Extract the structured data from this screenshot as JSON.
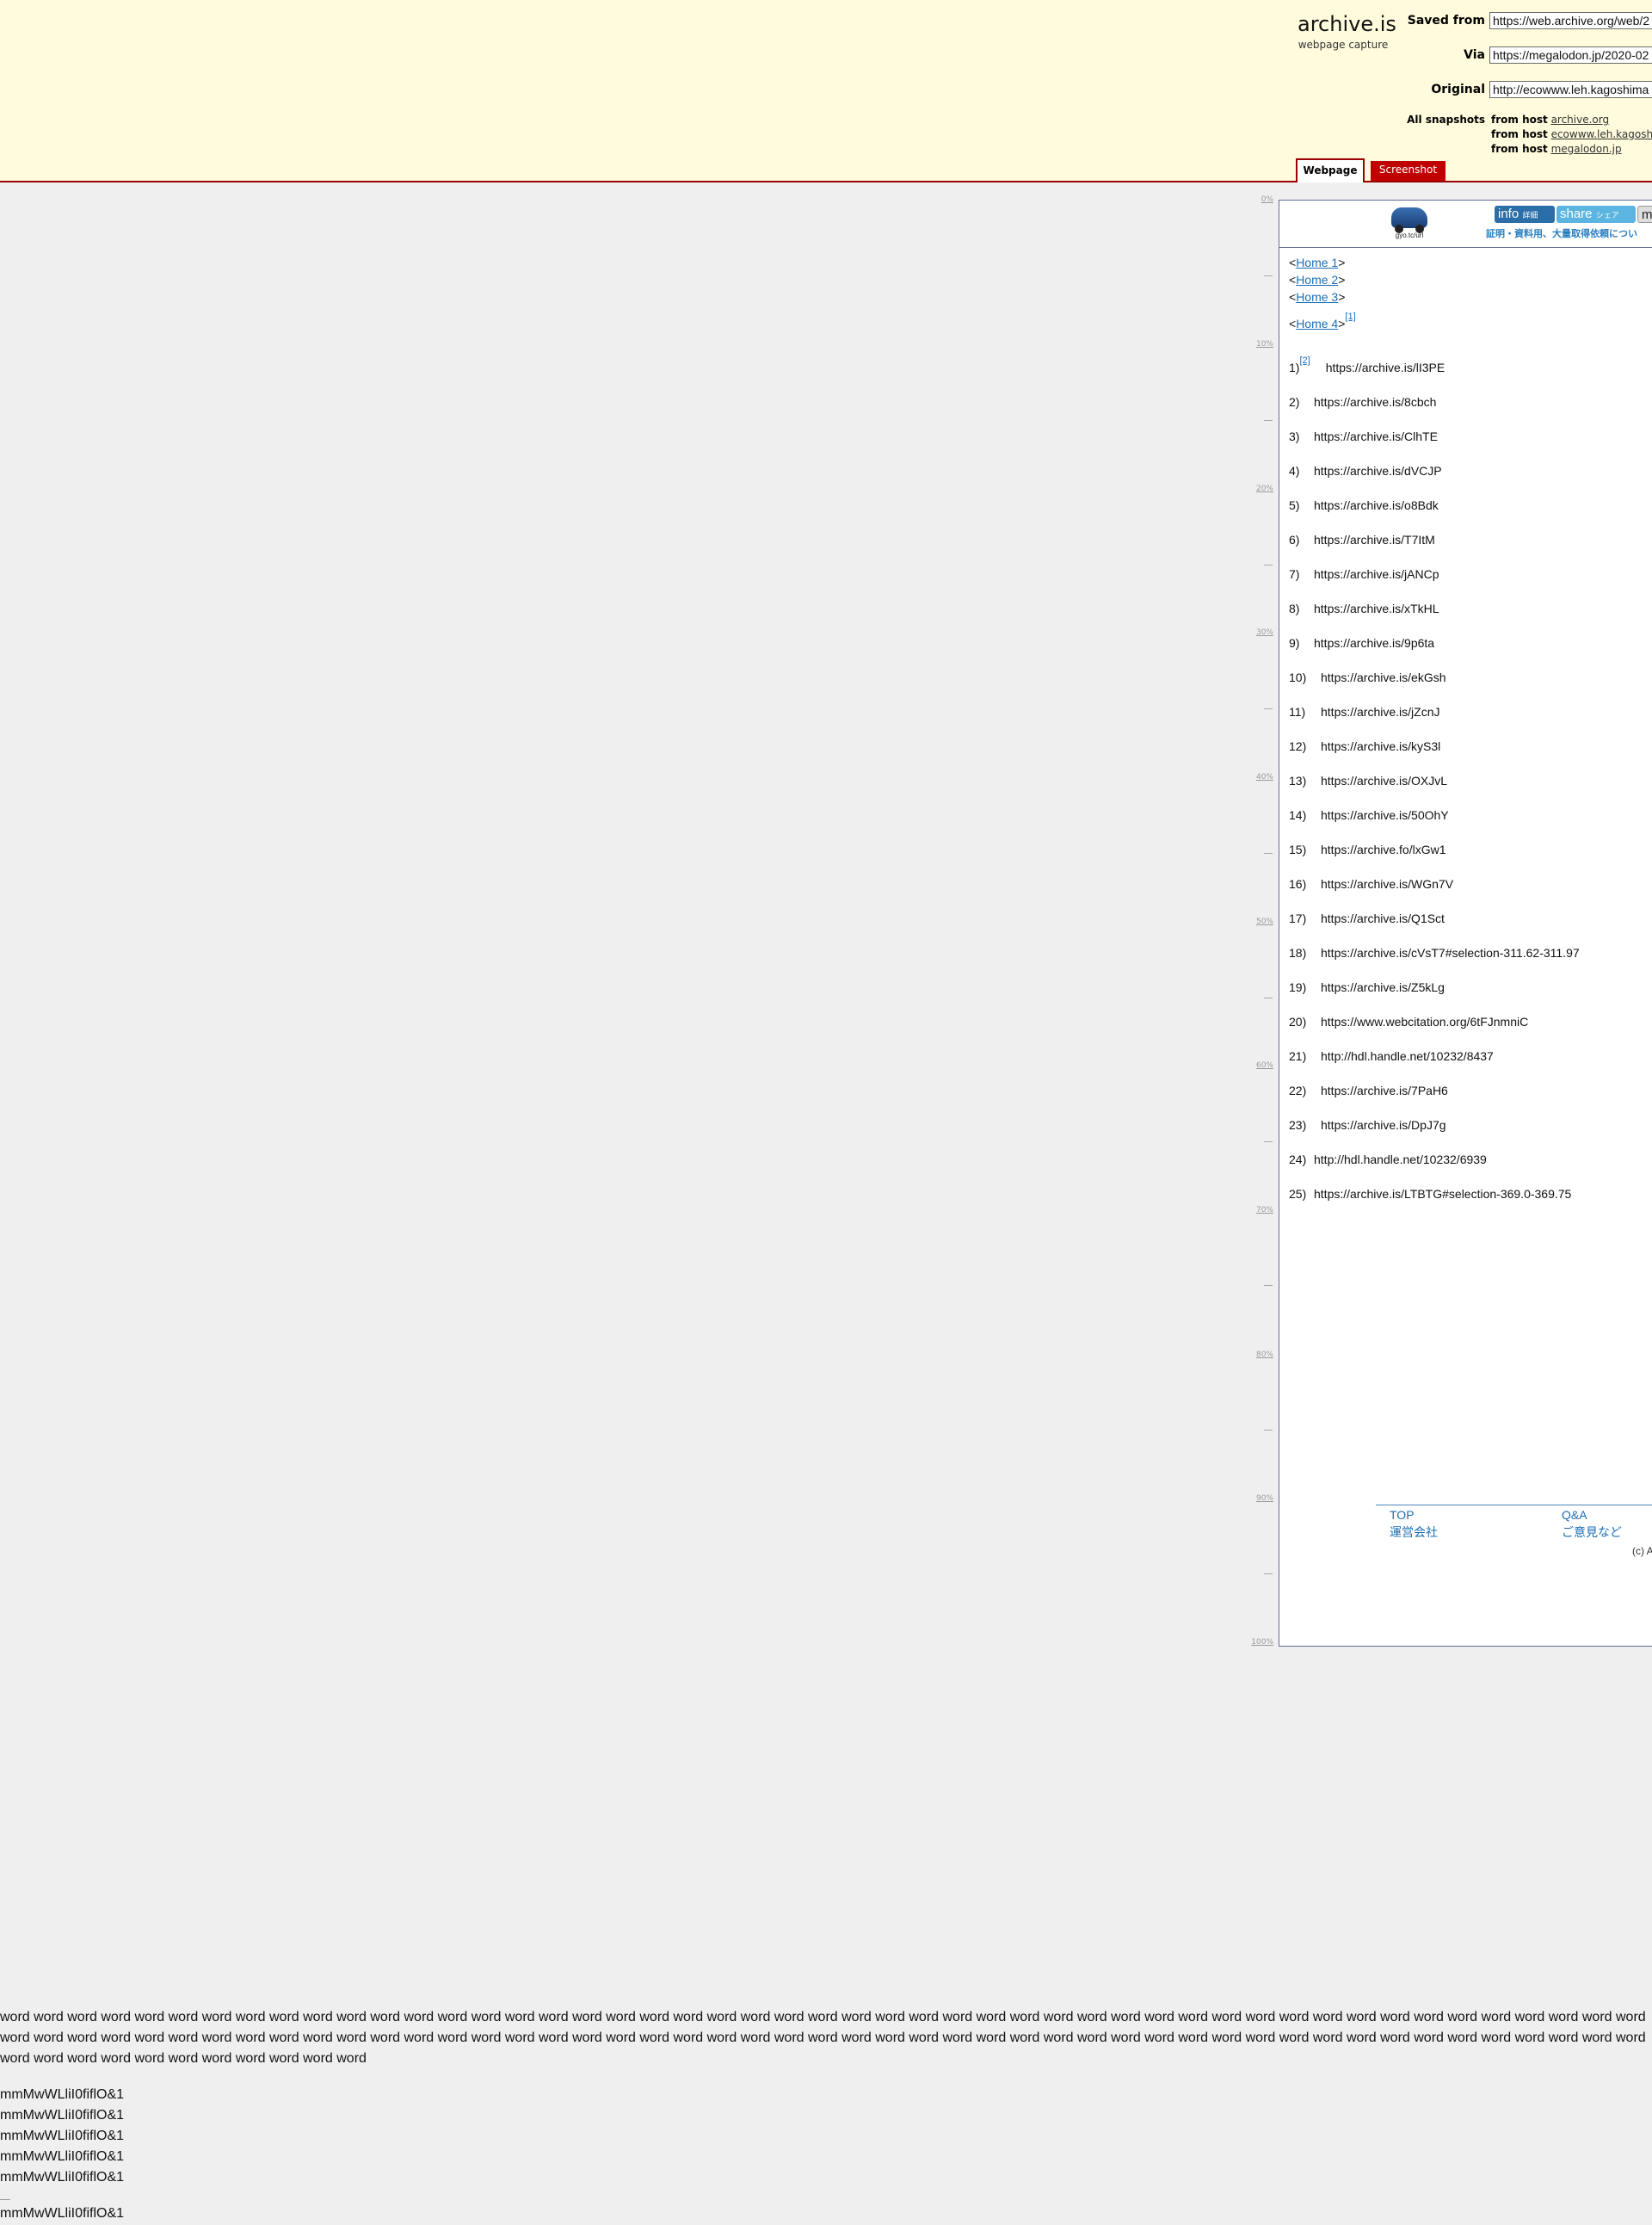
{
  "header": {
    "brand": "archive.is",
    "brand_sub": "webpage capture",
    "saved_from_label": "Saved from",
    "saved_from_value": "https://web.archive.org/web/2",
    "via_label": "Via",
    "via_value": "https://megalodon.jp/2020-02",
    "original_label": "Original",
    "original_value": "http://ecowww.leh.kagoshima",
    "all_snapshots_label": "All snapshots",
    "snapshots": [
      {
        "prefix": "from host",
        "host": "archive.org"
      },
      {
        "prefix": "from host",
        "host": "ecowww.leh.kagoshim"
      },
      {
        "prefix": "from host",
        "host": "megalodon.jp"
      }
    ],
    "tabs": {
      "webpage": "Webpage",
      "screenshot": "Screenshot"
    }
  },
  "ruler": [
    "0%",
    "10%",
    "20%",
    "30%",
    "40%",
    "50%",
    "60%",
    "70%",
    "80%",
    "90%",
    "100%"
  ],
  "captured": {
    "logo_text": "gyo.tc/url",
    "btn_info": "info",
    "btn_info_small": "詳細",
    "btn_share": "share",
    "btn_share_small": "シェア",
    "btn_more": "m",
    "top_note": "証明・資料用、大量取得依頼につい",
    "homes": [
      "Home 1",
      "Home 2",
      "Home 3",
      "Home 4"
    ],
    "fn1": "[1]",
    "fn2": "[2]",
    "items": [
      {
        "n": "1)",
        "url": "https://archive.is/lI3PE"
      },
      {
        "n": "2)",
        "url": "https://archive.is/8cbch"
      },
      {
        "n": "3)",
        "url": "https://archive.is/ClhTE"
      },
      {
        "n": "4)",
        "url": "https://archive.is/dVCJP"
      },
      {
        "n": "5)",
        "url": "https://archive.is/o8Bdk"
      },
      {
        "n": "6)",
        "url": "https://archive.is/T7ItM"
      },
      {
        "n": "7)",
        "url": "https://archive.is/jANCp"
      },
      {
        "n": "8)",
        "url": "https://archive.is/xTkHL"
      },
      {
        "n": "9)",
        "url": "https://archive.is/9p6ta"
      },
      {
        "n": "10)",
        "url": "https://archive.is/ekGsh"
      },
      {
        "n": "11)",
        "url": "https://archive.is/jZcnJ"
      },
      {
        "n": "12)",
        "url": "https://archive.is/kyS3l"
      },
      {
        "n": "13)",
        "url": "https://archive.is/OXJvL"
      },
      {
        "n": "14)",
        "url": "https://archive.is/50OhY"
      },
      {
        "n": "15)",
        "url": "https://archive.fo/lxGw1"
      },
      {
        "n": "16)",
        "url": "https://archive.is/WGn7V"
      },
      {
        "n": "17)",
        "url": "https://archive.is/Q1Sct"
      },
      {
        "n": "18)",
        "url": "https://archive.is/cVsT7#selection-311.62-311.97"
      },
      {
        "n": "19)",
        "url": "https://archive.is/Z5kLg"
      },
      {
        "n": "20)",
        "url": "https://www.webcitation.org/6tFJnmniC"
      },
      {
        "n": "21)",
        "url": "http://hdl.handle.net/10232/8437"
      },
      {
        "n": "22)",
        "url": "https://archive.is/7PaH6"
      },
      {
        "n": "23)",
        "url": "https://archive.is/DpJ7g"
      },
      {
        "n": "24)",
        "url": "http://hdl.handle.net/10232/6939"
      },
      {
        "n": "25)",
        "url": "https://archive.is/LTBTG#selection-369.0-369.75"
      }
    ],
    "footer": {
      "top": "TOP",
      "qa": "Q&A",
      "company": "運営会社",
      "feedback": "ご意見など",
      "copyright": "(c) A"
    }
  },
  "bottom": {
    "words": "word word word word word word word word word word word word word word word word word word word word word word word word word word word word word word word word word word word word word word word word word word word word word word word word word word word word word word word word word word word word word word word word word word word word word word word word word word word word word word word word word word word word word word word word word word word word word word word word word word word word word word word word word word word word word",
    "probe": "mmMwWLliI0fiflO&1"
  }
}
